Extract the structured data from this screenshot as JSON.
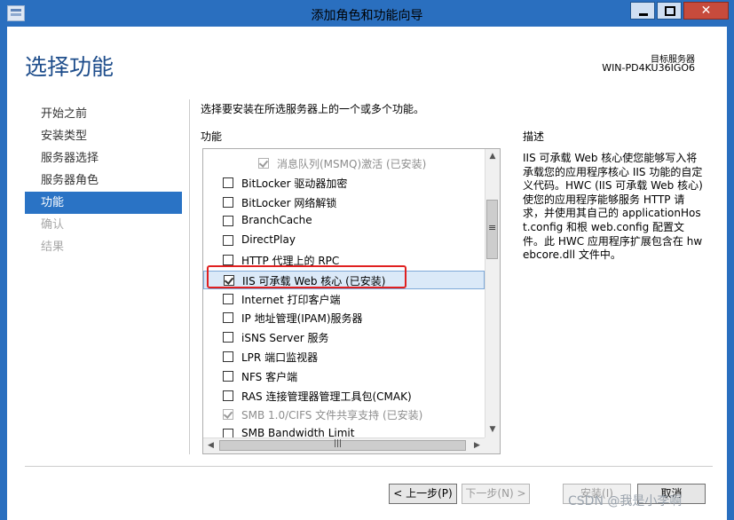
{
  "window": {
    "title": "添加角色和功能向导"
  },
  "header": {
    "page_title": "选择功能",
    "target_label": "目标服务器",
    "target_value": "WIN-PD4KU36IGO6"
  },
  "nav": {
    "items": [
      {
        "label": "开始之前",
        "state": "normal"
      },
      {
        "label": "安装类型",
        "state": "normal"
      },
      {
        "label": "服务器选择",
        "state": "normal"
      },
      {
        "label": "服务器角色",
        "state": "normal"
      },
      {
        "label": "功能",
        "state": "active"
      },
      {
        "label": "确认",
        "state": "disabled"
      },
      {
        "label": "结果",
        "state": "disabled"
      }
    ]
  },
  "main": {
    "instruction": "选择要安装在所选服务器上的一个或多个功能。",
    "features_label": "功能",
    "features": [
      {
        "label": "消息队列(MSMQ)激活 (已安装)",
        "checked": true,
        "disabled": true,
        "indent": 1
      },
      {
        "label": "BitLocker 驱动器加密",
        "checked": false,
        "disabled": false,
        "indent": 0
      },
      {
        "label": "BitLocker 网络解锁",
        "checked": false,
        "disabled": false,
        "indent": 0
      },
      {
        "label": "BranchCache",
        "checked": false,
        "disabled": false,
        "indent": 0
      },
      {
        "label": "DirectPlay",
        "checked": false,
        "disabled": false,
        "indent": 0
      },
      {
        "label": "HTTP 代理上的 RPC",
        "checked": false,
        "disabled": false,
        "indent": 0
      },
      {
        "label": "IIS 可承载 Web 核心 (已安装)",
        "checked": true,
        "disabled": false,
        "indent": 0,
        "selected": true
      },
      {
        "label": "Internet 打印客户端",
        "checked": false,
        "disabled": false,
        "indent": 0
      },
      {
        "label": "IP 地址管理(IPAM)服务器",
        "checked": false,
        "disabled": false,
        "indent": 0
      },
      {
        "label": "iSNS Server 服务",
        "checked": false,
        "disabled": false,
        "indent": 0
      },
      {
        "label": "LPR 端口监视器",
        "checked": false,
        "disabled": false,
        "indent": 0
      },
      {
        "label": "NFS 客户端",
        "checked": false,
        "disabled": false,
        "indent": 0
      },
      {
        "label": "RAS 连接管理器管理工具包(CMAK)",
        "checked": false,
        "disabled": false,
        "indent": 0
      },
      {
        "label": "SMB 1.0/CIFS 文件共享支持 (已安装)",
        "checked": true,
        "disabled": true,
        "indent": 0
      },
      {
        "label": "SMB Bandwidth Limit",
        "checked": false,
        "disabled": false,
        "indent": 0
      }
    ]
  },
  "description": {
    "label": "描述",
    "text": "IIS 可承载 Web 核心使您能够写入将承载您的应用程序核心 IIS 功能的自定义代码。HWC (IIS 可承载 Web 核心)使您的应用程序能够服务 HTTP 请求，并使用其自己的 applicationHost.config 和根 web.config 配置文件。此 HWC 应用程序扩展包含在 hwebcore.dll 文件中。"
  },
  "buttons": {
    "prev": "< 上一步(P)",
    "next": "下一步(N) >",
    "install": "安装(I)",
    "cancel": "取消"
  },
  "watermark": "CSDN @我是小李啊",
  "icons": {
    "app": "server-manager-icon",
    "checkbox_checked": "checkmark-icon"
  }
}
